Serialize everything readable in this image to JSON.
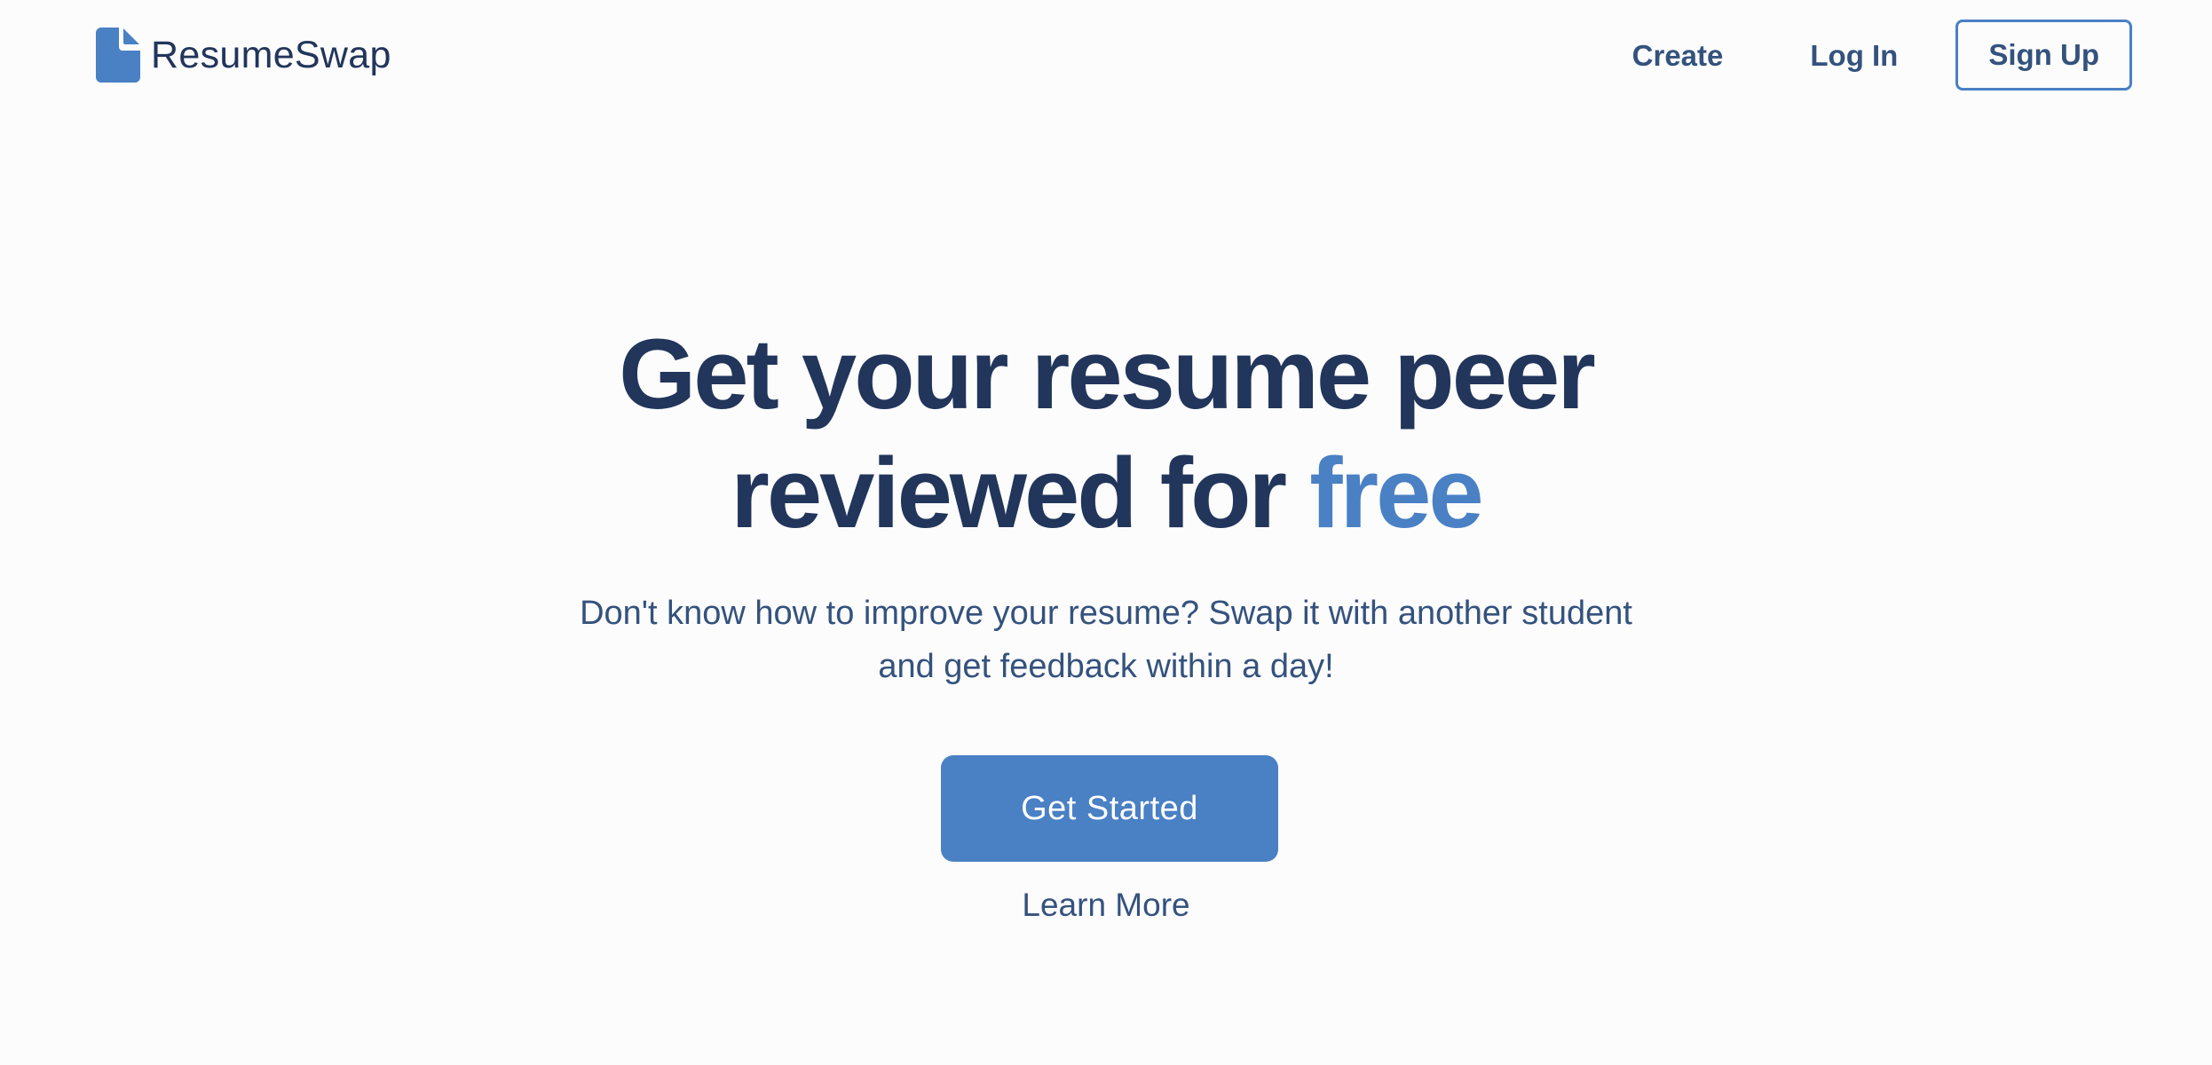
{
  "header": {
    "logo_text": "ResumeSwap",
    "nav": {
      "create": "Create",
      "login": "Log In",
      "signup": "Sign Up"
    }
  },
  "hero": {
    "headline_line1": "Get your resume peer",
    "headline_line2_prefix": "reviewed for ",
    "headline_accent": "free",
    "subtext": "Don't know how to improve your resume? Swap it with another student and get feedback within a day!",
    "cta_label": "Get Started",
    "learn_more_label": "Learn More"
  },
  "colors": {
    "background": "#fcfcfd",
    "primary_dark": "#22355b",
    "text_secondary": "#34527d",
    "accent": "#4a80c4",
    "button_text": "#ffffff"
  },
  "icons": {
    "logo": "document-icon"
  }
}
